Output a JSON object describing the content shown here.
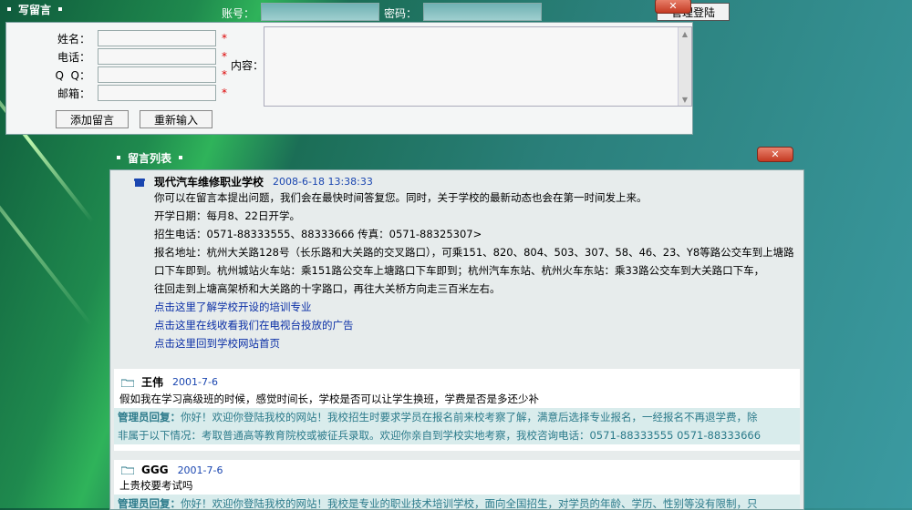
{
  "write_panel": {
    "title": "写留言",
    "account_label": "账号：",
    "password_label": "密码：",
    "login_button": "管理登陆",
    "close_glyph": "✕",
    "fields": [
      {
        "label": "姓名：",
        "required": "*"
      },
      {
        "label": "电话：",
        "required": "*"
      },
      {
        "label": "Q  Q：",
        "required": "*"
      },
      {
        "label": "邮箱：",
        "required": "*"
      }
    ],
    "content_label": "内容：",
    "add_button": "添加留言",
    "reset_button": "重新输入"
  },
  "list_panel": {
    "title": "留言列表",
    "close_glyph": "✕",
    "pinned": {
      "title": "现代汽车维修职业学校",
      "date": "2008-6-18 13:38:33",
      "lines": [
        "你可以在留言本提出问题，我们会在最快时间答复您。同时，关于学校的最新动态也会在第一时间发上来。",
        "开学日期：每月8、22日开学。",
        "招生电话：0571-88333555、88333666 传真：0571-88325307>",
        "报名地址：杭州大关路128号（长乐路和大关路的交叉路口），可乘151、820、804、503、307、58、46、23、Y8等路公交车到上塘路",
        "口下车即到。杭州城站火车站：乘151路公交车上塘路口下车即到；杭州汽车东站、杭州火车东站：乘33路公交车到大关路口下车，",
        "往回走到上塘高架桥和大关路的十字路口，再往大关桥方向走三百米左右。"
      ],
      "links": [
        "点击这里了解学校开设的培训专业",
        "点击这里在线收看我们在电视台投放的广告",
        "点击这里回到学校网站首页"
      ]
    },
    "entries": [
      {
        "name": "王伟",
        "date": "2001-7-6",
        "message": "假如我在学习高级班的时候，感觉时间长，学校是否可以让学生换班，学费是否是多还少补",
        "reply_label": "管理员回复：",
        "reply_1": "你好！欢迎你登陆我校的网站！我校招生时要求学员在报名前来校考察了解，满意后选择专业报名，一经报名不再退学费，除",
        "reply_2": "非属于以下情况：考取普通高等教育院校或被征兵录取。欢迎你亲自到学校实地考察，我校咨询电话：0571-88333555 0571-88333666"
      },
      {
        "name": "GGG",
        "date": "2001-7-6",
        "message": "上贵校要考试吗",
        "reply_label": "管理员回复：",
        "reply_1": "你好！欢迎你登陆我校的网站！我校是专业的职业技术培训学校，面向全国招生，对学员的年龄、学历、性别等没有限制，只"
      }
    ]
  },
  "colors": {
    "accent": "#1a46b0",
    "reply_bg": "#d9ecec",
    "reply_text": "#2b7a8a",
    "required": "#dd0000"
  }
}
